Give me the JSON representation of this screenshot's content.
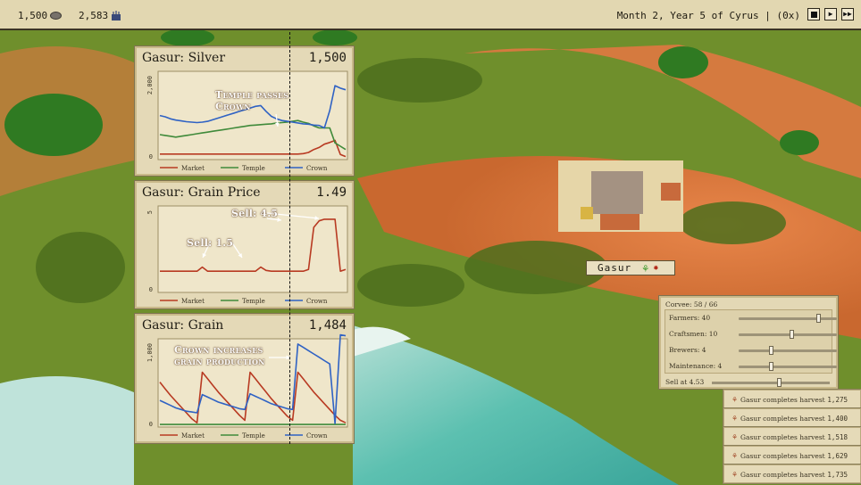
{
  "topbar": {
    "silver": "1,500",
    "grain": "2,583",
    "date": "Month 2, Year 5 of Cyrus | (0x)",
    "controls": {
      "play": "▶",
      "fast": "▶▶"
    }
  },
  "panels": {
    "silver": {
      "title": "Gasur: Silver",
      "value": "1,500",
      "ymax": "2,000",
      "ymin": "0",
      "annotations": [
        "Temple passes",
        "Crown"
      ]
    },
    "grain_price": {
      "title": "Gasur: Grain Price",
      "value": "1.49",
      "ymax": "5",
      "ymin": "0",
      "annotations": [
        "Sell: 4.5",
        "Sell: 1.5"
      ]
    },
    "grain": {
      "title": "Gasur: Grain",
      "value": "1,484",
      "ymax": "1,000",
      "ymin": "0",
      "annotations": [
        "Crown increases",
        "grain production"
      ]
    },
    "legend": [
      {
        "name": "Market",
        "color": "#b83a22"
      },
      {
        "name": "Temple",
        "color": "#3f8a3a"
      },
      {
        "name": "Crown",
        "color": "#2f62c4"
      }
    ]
  },
  "chart_data": [
    {
      "type": "line",
      "title": "Gasur: Silver",
      "ylim": [
        0,
        2000
      ],
      "x": [
        0,
        2,
        4,
        6,
        8,
        10,
        12,
        14,
        16,
        18,
        20,
        22,
        24,
        26,
        28,
        30,
        32,
        34,
        36,
        38,
        40,
        42,
        44,
        46,
        48,
        50,
        52,
        54,
        56,
        58,
        60,
        62,
        64,
        66,
        68,
        70
      ],
      "series": [
        {
          "name": "Market",
          "color": "#b83a22",
          "values": [
            90,
            90,
            90,
            90,
            90,
            90,
            90,
            90,
            90,
            90,
            90,
            90,
            90,
            90,
            90,
            90,
            90,
            90,
            90,
            90,
            90,
            90,
            90,
            90,
            90,
            90,
            90,
            100,
            130,
            200,
            250,
            330,
            370,
            420,
            80,
            30
          ]
        },
        {
          "name": "Temple",
          "color": "#3f8a3a",
          "values": [
            560,
            540,
            520,
            500,
            520,
            540,
            560,
            580,
            600,
            620,
            640,
            660,
            680,
            700,
            720,
            740,
            760,
            780,
            790,
            800,
            810,
            820,
            840,
            850,
            860,
            880,
            900,
            860,
            830,
            770,
            720,
            720,
            720,
            360,
            280,
            200
          ]
        },
        {
          "name": "Crown",
          "color": "#2f62c4",
          "values": [
            1020,
            990,
            940,
            910,
            890,
            870,
            860,
            850,
            860,
            880,
            920,
            960,
            1000,
            1040,
            1080,
            1120,
            1160,
            1200,
            1240,
            1260,
            1120,
            1000,
            940,
            900,
            880,
            860,
            840,
            820,
            810,
            790,
            780,
            720,
            1140,
            1740,
            1680,
            1640
          ]
        }
      ]
    },
    {
      "type": "line",
      "title": "Gasur: Grain Price",
      "ylim": [
        0,
        5
      ],
      "x": [
        0,
        2,
        4,
        6,
        8,
        10,
        12,
        14,
        16,
        18,
        20,
        22,
        24,
        26,
        28,
        30,
        32,
        34,
        36,
        38,
        40,
        42,
        44,
        46,
        48,
        50,
        52,
        54,
        56,
        58,
        60,
        62,
        64,
        66,
        68,
        70
      ],
      "series": [
        {
          "name": "Market",
          "color": "#b83a22",
          "values": [
            1.2,
            1.2,
            1.2,
            1.2,
            1.2,
            1.2,
            1.2,
            1.2,
            1.45,
            1.2,
            1.2,
            1.2,
            1.2,
            1.2,
            1.2,
            1.2,
            1.2,
            1.2,
            1.2,
            1.45,
            1.25,
            1.2,
            1.2,
            1.2,
            1.2,
            1.2,
            1.2,
            1.2,
            1.3,
            3.9,
            4.3,
            4.4,
            4.4,
            4.4,
            1.2,
            1.3
          ]
        },
        {
          "name": "Temple",
          "color": "#3f8a3a",
          "values": []
        },
        {
          "name": "Crown",
          "color": "#2f62c4",
          "values": []
        }
      ]
    },
    {
      "type": "line",
      "title": "Gasur: Grain",
      "ylim": [
        0,
        1000
      ],
      "x": [
        0,
        2,
        4,
        6,
        8,
        10,
        12,
        14,
        16,
        18,
        20,
        22,
        24,
        26,
        28,
        30,
        32,
        34,
        36,
        38,
        40,
        42,
        44,
        46,
        48,
        50,
        52,
        54,
        56,
        58,
        60,
        62,
        64,
        66,
        68,
        70
      ],
      "series": [
        {
          "name": "Market",
          "color": "#b83a22",
          "values": [
            520,
            440,
            360,
            290,
            220,
            150,
            80,
            30,
            640,
            560,
            480,
            400,
            330,
            260,
            190,
            120,
            60,
            640,
            560,
            480,
            400,
            320,
            250,
            180,
            110,
            60,
            640,
            560,
            480,
            400,
            330,
            260,
            190,
            120,
            60,
            30
          ]
        },
        {
          "name": "Temple",
          "color": "#3f8a3a",
          "values": [
            10,
            10,
            10,
            10,
            10,
            10,
            10,
            10,
            10,
            10,
            10,
            10,
            10,
            10,
            10,
            10,
            10,
            10,
            10,
            10,
            10,
            10,
            10,
            10,
            10,
            10,
            10,
            10,
            10,
            10,
            10,
            10,
            10,
            10,
            10,
            10
          ]
        },
        {
          "name": "Crown",
          "color": "#2f62c4",
          "values": [
            300,
            270,
            240,
            210,
            190,
            170,
            160,
            150,
            370,
            340,
            310,
            280,
            260,
            240,
            220,
            200,
            190,
            380,
            350,
            320,
            290,
            260,
            240,
            220,
            200,
            190,
            980,
            940,
            900,
            860,
            820,
            780,
            740,
            20,
            1090,
            1080
          ]
        }
      ]
    }
  ],
  "city": {
    "name": "Gasur",
    "icon": "grain-leaf-icon",
    "status_icon": "warning-icon"
  },
  "labor": {
    "corvee": "Corvee: 58 / 66",
    "rows": [
      {
        "label": "Farmers: 40",
        "level": 0.84
      },
      {
        "label": "Craftsmen: 10",
        "level": 0.55
      },
      {
        "label": "Brewers: 4",
        "level": 0.33
      },
      {
        "label": "Maintenance: 4",
        "level": 0.33
      }
    ],
    "sell": "Sell at 4.53",
    "sell_level": 0.58
  },
  "notifications": [
    {
      "text": "Gasur completes harvest",
      "value": "1,275"
    },
    {
      "text": "Gasur completes harvest",
      "value": "1,400"
    },
    {
      "text": "Gasur completes harvest",
      "value": "1,518"
    },
    {
      "text": "Gasur completes harvest",
      "value": "1,629"
    },
    {
      "text": "Gasur completes harvest",
      "value": "1,735"
    }
  ]
}
